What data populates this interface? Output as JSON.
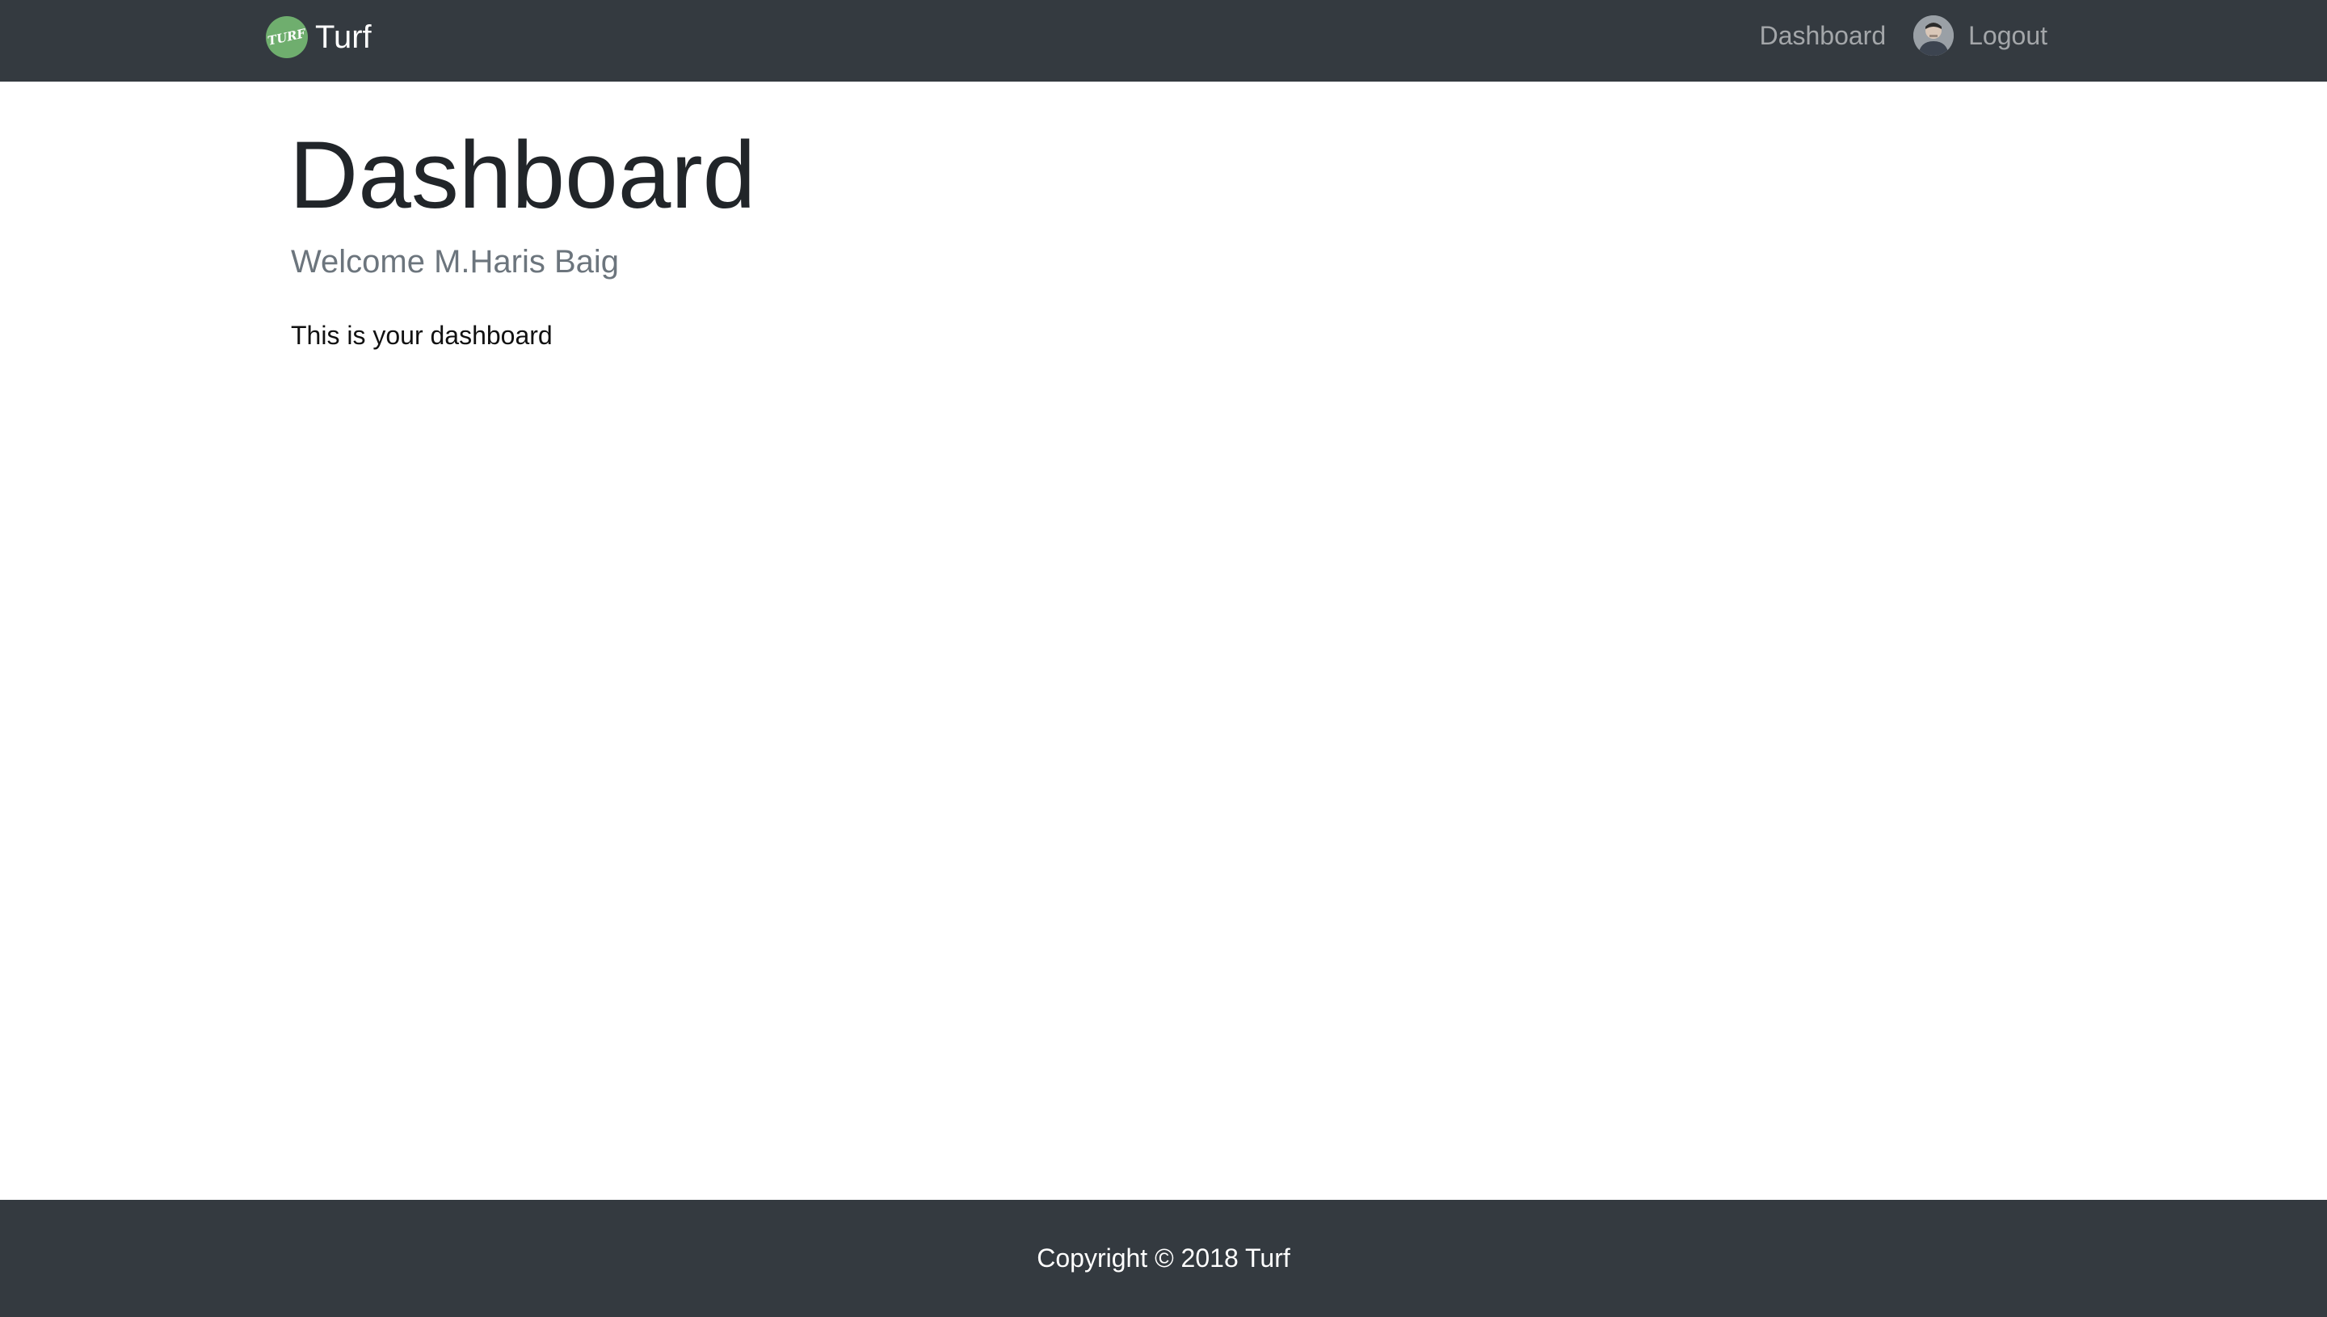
{
  "navbar": {
    "brand": {
      "logo_text": "TURF",
      "logo_icon": "turf-logo-icon",
      "name": "Turf"
    },
    "links": {
      "dashboard": "Dashboard",
      "logout": "Logout"
    },
    "avatar_icon": "user-avatar"
  },
  "main": {
    "title": "Dashboard",
    "welcome": "Welcome M.Haris Baig",
    "body": "This is your dashboard"
  },
  "footer": {
    "copyright": "Copyright © 2018 Turf"
  },
  "colors": {
    "navbar_bg": "#343a40",
    "footer_bg": "#343a40",
    "logo_green": "#6fae6e",
    "muted_text": "#6c757d",
    "nav_link": "rgba(255,255,255,0.55)"
  }
}
